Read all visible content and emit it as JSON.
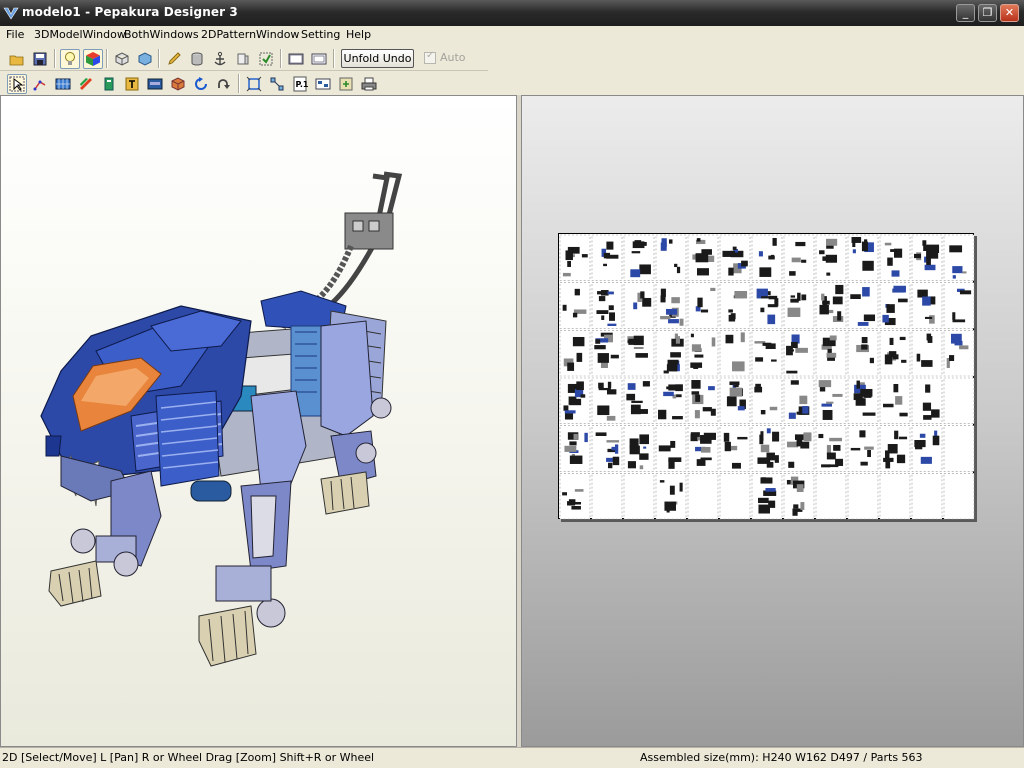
{
  "window": {
    "title": "modelo1 - Pepakura Designer 3"
  },
  "menu": [
    "File",
    "3DModelWindow",
    "BothWindows",
    "2DPatternWindow",
    "Setting",
    "Help"
  ],
  "toolbar1": {
    "unfold_undo_label": "Unfold Undo",
    "auto_label": "Auto",
    "auto_checked": true,
    "auto_enabled": false,
    "icons": [
      "open-icon",
      "save-icon",
      "light-icon",
      "texture-cube-icon",
      "wireframe-box-icon",
      "box-icon",
      "pencil-icon",
      "cylinder-icon",
      "anchor-icon",
      "paper-cut-icon",
      "print-check-icon",
      "single-window-icon",
      "both-window-icon"
    ]
  },
  "toolbar2": {
    "icons": [
      "select-arrow-icon",
      "join-edge-icon",
      "grid-icon",
      "color-icon",
      "book-icon",
      "window-icon",
      "text-icon",
      "image-icon",
      "box-3d-icon",
      "rotate-icon",
      "redo-icon",
      "fit-icon",
      "snap-icon",
      "page-number-icon",
      "layout-icon",
      "reset-icon",
      "print-icon"
    ]
  },
  "pattern": {
    "columns": 13,
    "rows": 6
  },
  "status": {
    "left": "2D [Select/Move] L [Pan] R or Wheel Drag [Zoom] Shift+R or Wheel",
    "right": "Assembled size(mm): H240 W162 D497 / Parts 563"
  },
  "colors": {
    "model_blue": "#2d49a8",
    "model_orange": "#e8843c",
    "titlebar": "#2b2b2b"
  }
}
